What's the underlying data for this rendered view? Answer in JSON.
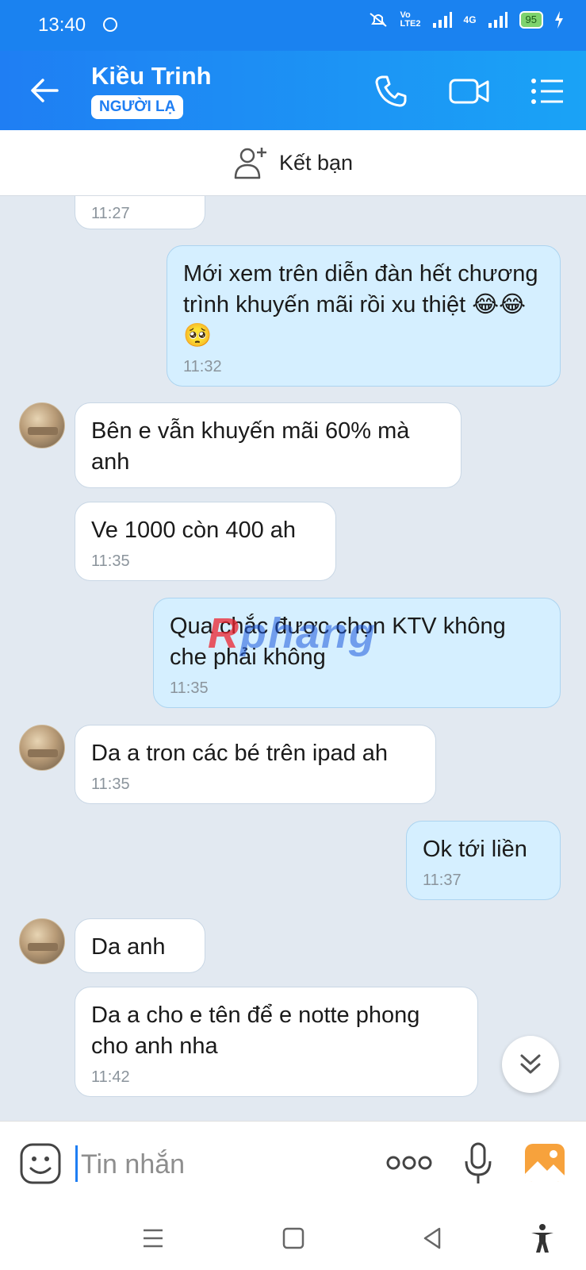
{
  "status_bar": {
    "time": "13:40",
    "network": "4G",
    "battery": "95"
  },
  "header": {
    "contact_name": "Kiều Trinh",
    "badge": "NGƯỜI LẠ"
  },
  "add_friend": {
    "label": "Kết bạn"
  },
  "messages": [
    {
      "side": "in",
      "text": "",
      "time": "11:27"
    },
    {
      "side": "out",
      "text": "Mới xem trên diễn đàn hết chương trình khuyến mãi rồi xu thiệt 😂😂🥺",
      "time": "11:32"
    },
    {
      "side": "in",
      "text": "Bên e vẫn khuyến mãi 60% mà anh",
      "time": ""
    },
    {
      "side": "in",
      "text": "Ve 1000 còn 400 ah",
      "time": "11:35"
    },
    {
      "side": "out",
      "text": "Qua chắc được chọn KTV không che phải không",
      "time": "11:35"
    },
    {
      "side": "in",
      "text": "Da a tron các bé trên ipad ah",
      "time": "11:35"
    },
    {
      "side": "out",
      "text": "Ok tới liền",
      "time": "11:37"
    },
    {
      "side": "in",
      "text": "Da anh",
      "time": ""
    },
    {
      "side": "in",
      "text": "Da a cho e tên để e notte phong cho anh nha",
      "time": "11:42"
    }
  ],
  "watermark": {
    "prefix": "R",
    "rest": "phang"
  },
  "input": {
    "placeholder": "Tin nhắn"
  },
  "colors": {
    "header": "#1f7ef3",
    "outgoing_bubble": "#d5efff",
    "incoming_bubble": "#ffffff",
    "chat_background": "#e2e9f1"
  },
  "icons": [
    "back-arrow-icon",
    "phone-icon",
    "video-call-icon",
    "menu-list-icon",
    "add-friend-icon",
    "emoji-icon",
    "more-icon",
    "mic-icon",
    "image-icon",
    "chevron-double-down-icon"
  ]
}
